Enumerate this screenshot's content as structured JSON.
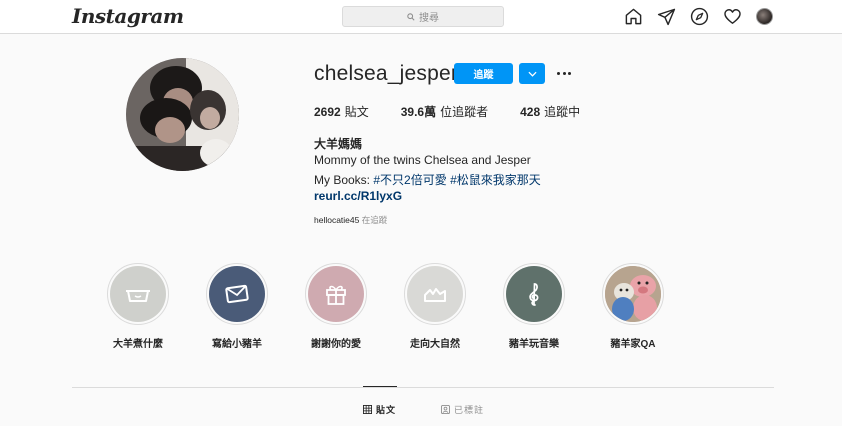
{
  "nav": {
    "logo": "Instagram",
    "search_placeholder": "搜尋",
    "icons": [
      "home-icon",
      "direct-icon",
      "explore-icon",
      "activity-heart-icon",
      "profile-avatar"
    ]
  },
  "profile": {
    "username": "chelsea_jesper",
    "follow_label": "追蹤",
    "stats": [
      {
        "value": "2692",
        "label": "貼文"
      },
      {
        "value": "39.6萬",
        "label": "位追蹤者"
      },
      {
        "value": "428",
        "label": "追蹤中"
      }
    ],
    "full_name": "大羊媽媽",
    "bio_line1": "Mommy of the twins Chelsea and Jesper",
    "bio_line2_prefix": "My Books: ",
    "bio_tags": [
      "#不只2倍可愛",
      "#松鼠來我家那天"
    ],
    "link": "reurl.cc/R1lyxG",
    "followed_by_user": "hellocatie45",
    "followed_by_suffix": " 在追蹤"
  },
  "highlights": [
    {
      "label": "大羊煮什麼",
      "icon": "pot-icon",
      "color": "#cfd0cc"
    },
    {
      "label": "寫給小豬羊",
      "icon": "envelope-icon",
      "color": "#4a5b78"
    },
    {
      "label": "謝謝你的愛",
      "icon": "gift-icon",
      "color": "#cfaab0"
    },
    {
      "label": "走向大自然",
      "icon": "mountain-icon",
      "color": "#d9d9d6"
    },
    {
      "label": "豬羊玩音樂",
      "icon": "treble-clef-icon",
      "color": "#5f716b"
    },
    {
      "label": "豬羊家QA",
      "icon": "plush-toys-photo",
      "color": "#c9b8a8"
    }
  ],
  "tabs": [
    {
      "label": "貼文",
      "icon": "grid-icon",
      "active": true
    },
    {
      "label": "已標註",
      "icon": "tagged-icon",
      "active": false
    }
  ],
  "colors": {
    "accent": "#0095f6",
    "link": "#00376b",
    "muted": "#8e8e8e",
    "background": "#fafafa"
  }
}
